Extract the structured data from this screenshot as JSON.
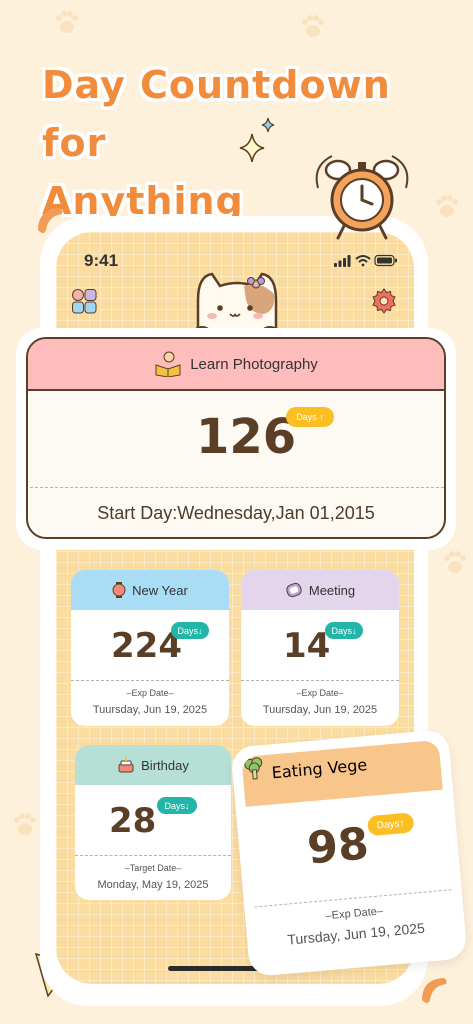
{
  "headline": {
    "line1": "Day Countdown for",
    "line2": "Anything"
  },
  "status_bar": {
    "time": "9:41"
  },
  "hero_card": {
    "title": "Learn Photography",
    "number": "126",
    "badge": "Days ↑",
    "footer": "Start Day:Wednesday,Jan 01,2015",
    "header_color": "#ffbcbc"
  },
  "cards": [
    {
      "title": "New Year",
      "number": "224",
      "badge": "Days↓",
      "label": "–Exp Date–",
      "date": "Tuursday, Jun 19, 2025",
      "header_color": "#a9dcf5"
    },
    {
      "title": "Meeting",
      "number": "14",
      "badge": "Days↓",
      "label": "–Exp Date–",
      "date": "Tuursday, Jun 19, 2025",
      "header_color": "#e2d5ec"
    },
    {
      "title": "Birthday",
      "number": "28",
      "badge": "Days↓",
      "label": "–Target Date–",
      "date": "Monday, May 19, 2025",
      "header_color": "#b6e0d6"
    },
    {
      "title": "Eating Vege",
      "number": "98",
      "badge": "Days↑",
      "label": "–Exp Date–",
      "date": "Tursday, Jun 19, 2025",
      "header_color": "#f8c68b"
    }
  ],
  "colors": {
    "accent": "#f28c3d",
    "badge_yellow": "#fbbf24",
    "badge_teal": "#22b5a8",
    "number_brown": "#5a3e26"
  }
}
